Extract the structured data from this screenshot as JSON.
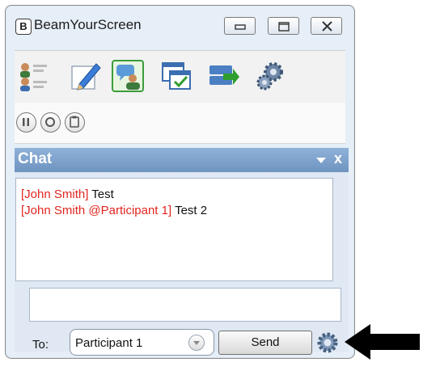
{
  "window": {
    "logo_letter": "B",
    "title": "BeamYourScreen",
    "buttons": [
      "minimize",
      "maximize",
      "close"
    ]
  },
  "toolbar": {
    "tools": [
      {
        "name": "participants-icon"
      },
      {
        "name": "annotate-pencil-icon"
      },
      {
        "name": "chat-icon",
        "selected": true
      },
      {
        "name": "screen-share-icon"
      },
      {
        "name": "file-transfer-icon"
      },
      {
        "name": "settings-gears-icon"
      }
    ]
  },
  "controls": [
    "pause",
    "record",
    "clipboard"
  ],
  "chat": {
    "title": "Chat",
    "close_label": "x",
    "messages": [
      {
        "sender": "[John Smith]",
        "text": "Test"
      },
      {
        "sender": "[John Smith @Participant 1]",
        "text": "Test 2"
      }
    ],
    "compose_value": "",
    "to_label": "To:",
    "recipient": "Participant 1",
    "send_label": "Send"
  },
  "colors": {
    "header": "#7aa0cb",
    "sender": "#e0261f",
    "selected_tool": "#3c9c3c"
  }
}
